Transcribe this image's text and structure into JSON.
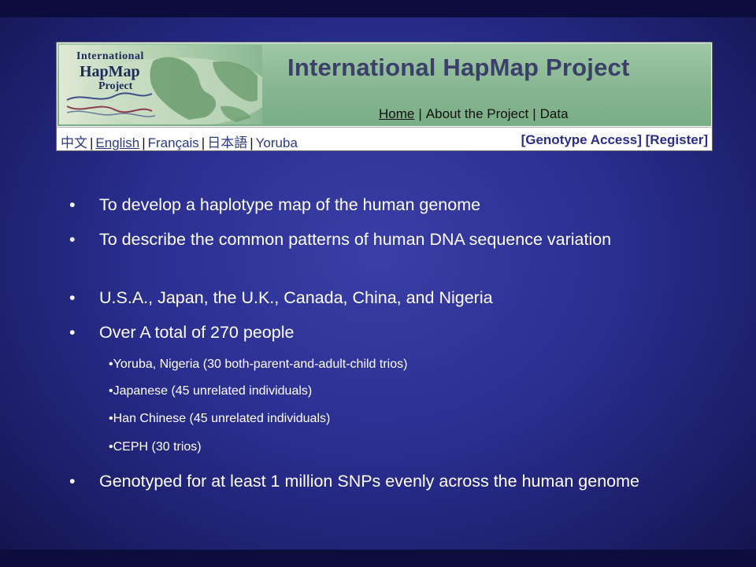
{
  "banner": {
    "logo": {
      "line1": "International",
      "line2": "HapMap",
      "line3": "Project"
    },
    "title": "International HapMap Project",
    "nav": {
      "home": "Home",
      "about": "About the Project",
      "data": "Data",
      "separator": "|"
    },
    "languages": [
      "中文",
      "English",
      "Français",
      "日本語",
      "Yoruba"
    ],
    "access": "[Genotype Access] [Register]"
  },
  "bullets": [
    {
      "level": 1,
      "text": "To develop a haplotype map of the human genome"
    },
    {
      "level": 1,
      "text": "To describe the common patterns of human DNA sequence variation"
    },
    {
      "level": 1,
      "text": "U.S.A., Japan, the U.K., Canada, China, and Nigeria"
    },
    {
      "level": 1,
      "text": "Over A total of 270 people"
    },
    {
      "level": 2,
      "text": "Yoruba, Nigeria (30 both-parent-and-adult-child trios)"
    },
    {
      "level": 2,
      "text": "Japanese (45 unrelated individuals)"
    },
    {
      "level": 2,
      "text": "Han Chinese (45 unrelated individuals)"
    },
    {
      "level": 2,
      "text": "CEPH (30 trios)"
    },
    {
      "level": 1,
      "text": "Genotyped for at least 1 million SNPs evenly across the human genome"
    }
  ],
  "bullet_glyph": "•"
}
